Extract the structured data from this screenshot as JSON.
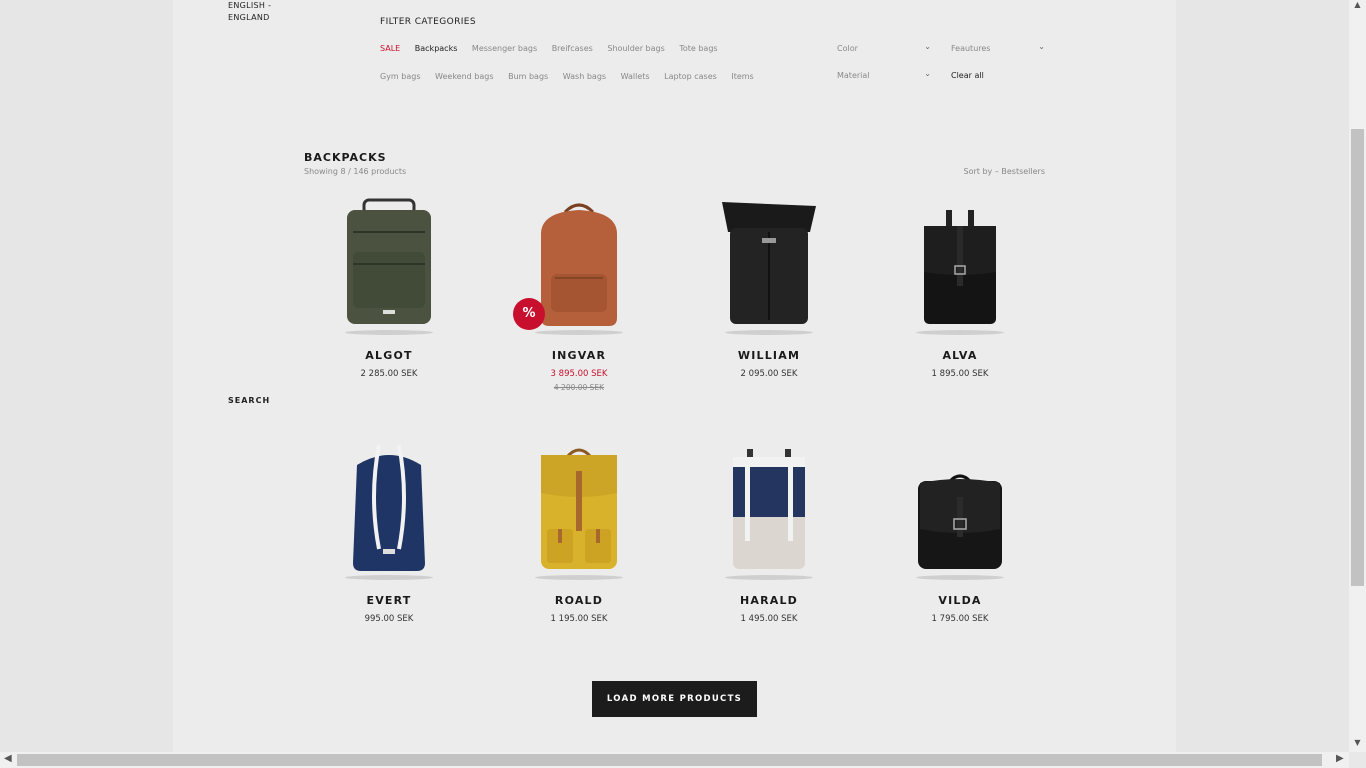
{
  "sidebar": {
    "language": "ENGLISH -\nENGLAND",
    "search_label": "SEARCH"
  },
  "filters": {
    "title": "FILTER CATEGORIES",
    "row1": [
      "SALE",
      "Backpacks",
      "Messenger bags",
      "Breifcases",
      "Shoulder bags",
      "Tote bags"
    ],
    "row2": [
      "Gym bags",
      "Weekend bags",
      "Bum bags",
      "Wash bags",
      "Wallets",
      "Laptop cases",
      "Items"
    ],
    "active": "Backpacks",
    "dropdowns": {
      "color": "Color",
      "features": "Feautures",
      "material": "Material"
    },
    "clear_all": "Clear all"
  },
  "listing": {
    "title": "BACKPACKS",
    "count": "Showing 8 / 146 products",
    "sort": "Sort by – Bestsellers"
  },
  "products": [
    {
      "name": "ALGOT",
      "price": "2 285.00 SEK",
      "color": "#4b5340",
      "icon": "backpack-icon"
    },
    {
      "name": "INGVAR",
      "price": "3 895.00 SEK",
      "old_price": "4 200.00 SEK",
      "badge": "%",
      "color": "#b5603a",
      "icon": "backpack-icon"
    },
    {
      "name": "WILLIAM",
      "price": "2 095.00 SEK",
      "color": "#222222",
      "icon": "backpack-icon"
    },
    {
      "name": "ALVA",
      "price": "1 895.00 SEK",
      "color": "#141414",
      "icon": "backpack-icon"
    },
    {
      "name": "EVERT",
      "price": "995.00 SEK",
      "color": "#1f3566",
      "icon": "backpack-icon"
    },
    {
      "name": "ROALD",
      "price": "1 195.00 SEK",
      "color": "#d9b22c",
      "icon": "backpack-icon"
    },
    {
      "name": "HARALD",
      "price": "1 495.00 SEK",
      "color": "#24355f",
      "icon": "backpack-icon"
    },
    {
      "name": "VILDA",
      "price": "1 795.00 SEK",
      "color": "#161616",
      "icon": "backpack-icon"
    }
  ],
  "load_more": "LOAD MORE PRODUCTS"
}
